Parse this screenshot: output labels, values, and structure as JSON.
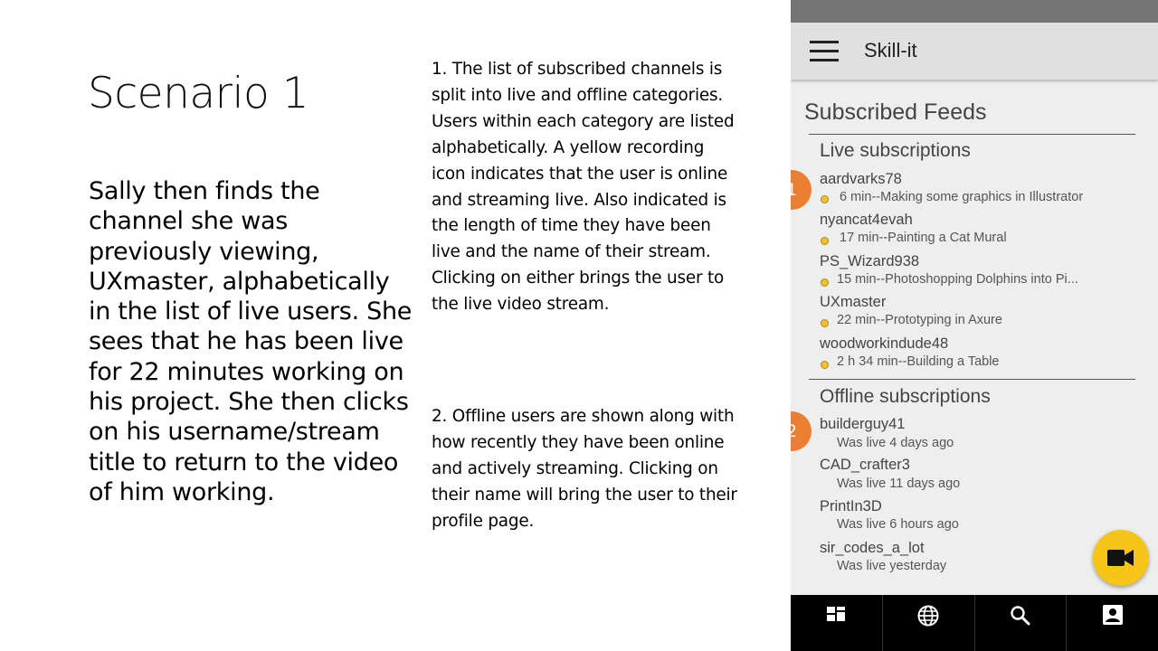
{
  "slide": {
    "title": "Scenario 1",
    "story": "Sally then finds the channel she was previously viewing, UXmaster, alphabetically in the list of live users. She sees that he has been live for 22 minutes working on his project. She then clicks on his username/stream title to return to the video of him working.",
    "note1": "1. The list of subscribed channels is split into live and offline categories. Users within each category are listed alphabetically. A yellow recording icon indicates that the user is online and streaming live. Also indicated is the length of time they have been live and the name of their stream. Clicking on either brings the user to the live video stream.",
    "note2": "2. Offline users are shown along with how recently they have been online and actively streaming. Clicking on their name will bring the user to their profile page."
  },
  "app": {
    "title": "Skill-it",
    "feeds_title": "Subscribed Feeds",
    "live_title": "Live subscriptions",
    "offline_title": "Offline subscriptions",
    "badge1": "1",
    "badge2": "2",
    "live_users": [
      {
        "name": "aardvarks78",
        "stream": "6 min--Making some graphics in Illustrator"
      },
      {
        "name": "nyancat4evah",
        "stream": "17 min--Painting a Cat Mural"
      },
      {
        "name": "PS_Wizard938",
        "stream": "15 min--Photoshopping Dolphins into Pi..."
      },
      {
        "name": "UXmaster",
        "stream": "22 min--Prototyping in Axure"
      },
      {
        "name": "woodworkindude48",
        "stream": "2 h 34 min--Building a Table"
      }
    ],
    "offline_users": [
      {
        "name": "builderguy41",
        "status": "Was live 4 days ago"
      },
      {
        "name": "CAD_crafter3",
        "status": "Was live 11 days ago"
      },
      {
        "name": "PrintIn3D",
        "status": "Was live 6 hours ago"
      },
      {
        "name": "sir_codes_a_lot",
        "status": "Was live yesterday"
      }
    ],
    "icons": {
      "menu": "menu-icon",
      "fab": "video-camera-icon",
      "nav": [
        "dashboard-icon",
        "globe-icon",
        "search-icon",
        "account-box-icon"
      ]
    },
    "colors": {
      "live_dot": "#f2c12e",
      "badge": "#ed7d31",
      "fab": "#f5c518",
      "bottom_nav": "#000000"
    }
  }
}
